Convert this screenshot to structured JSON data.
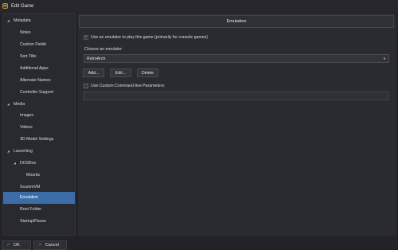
{
  "window": {
    "title": "Edit Game"
  },
  "sidebar": {
    "items": [
      {
        "label": "Metadata",
        "expanded": true
      },
      {
        "label": "Notes"
      },
      {
        "label": "Custom Fields"
      },
      {
        "label": "Sort Title"
      },
      {
        "label": "Additional Apps"
      },
      {
        "label": "Alternate Names"
      },
      {
        "label": "Controller Support"
      },
      {
        "label": "Media",
        "expanded": true
      },
      {
        "label": "Images"
      },
      {
        "label": "Videos"
      },
      {
        "label": "3D Model Settings"
      },
      {
        "label": "Launching",
        "expanded": true
      },
      {
        "label": "DOSBox",
        "expanded": true
      },
      {
        "label": "Mounts"
      },
      {
        "label": "ScummVM"
      },
      {
        "label": "Emulation",
        "selected": true
      },
      {
        "label": "Root Folder"
      },
      {
        "label": "Startup/Pause"
      }
    ],
    "selected_color": "#3b6ea8"
  },
  "main": {
    "header": "Emulation",
    "use_emulator": {
      "label": "Use an emulator to play this game (primarily for console games)",
      "checked": true
    },
    "choose_label": "Choose an emulator:",
    "emulator": {
      "selected": "RetroArch"
    },
    "buttons": {
      "add": "Add...",
      "edit": "Edit...",
      "delete": "Delete"
    },
    "custom_params": {
      "label": "Use Custom Command-line Parameters:",
      "checked": false,
      "value": ""
    }
  },
  "footer": {
    "ok": "OK",
    "cancel": "Cancel",
    "ok_color": "#4caf50",
    "cancel_color": "#e53935"
  }
}
